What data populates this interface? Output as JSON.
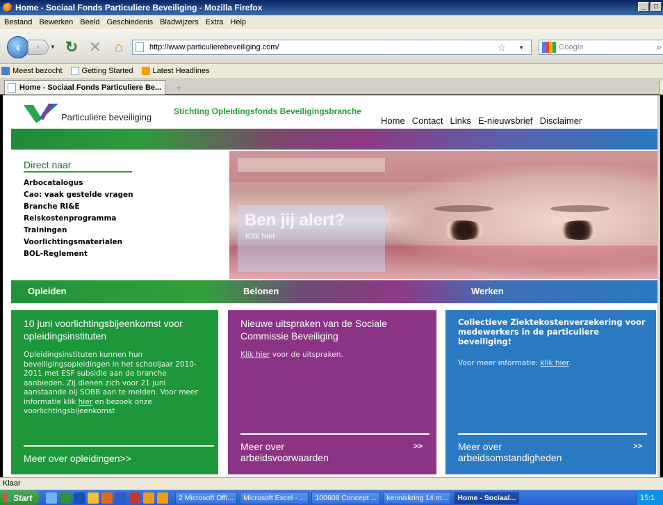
{
  "window": {
    "title": "Home - Sociaal Fonds Particuliere Beveiliging - Mozilla Firefox",
    "min_label": "_",
    "max_label": "□"
  },
  "menu": [
    "Bestand",
    "Bewerken",
    "Beeld",
    "Geschiedenis",
    "Bladwijzers",
    "Extra",
    "Help"
  ],
  "navbar": {
    "url": "http://www.particulierebeveiliging.com/",
    "search_placeholder": "Google"
  },
  "bookmarks": [
    "Meest bezocht",
    "Getting Started",
    "Latest Headlines"
  ],
  "tab": {
    "label": "Home - Sociaal Fonds Particuliere Be..."
  },
  "site": {
    "logo_text": "Particuliere beveiliging",
    "foundation": "Stichting Opleidingsfonds Beveiligingsbranche",
    "nav": [
      "Home",
      "Contact",
      "Links",
      "E-nieuwsbrief",
      "Disclaimer"
    ],
    "direct_title": "Direct naar",
    "direct_links": [
      "Arbocatalogus",
      "Cao: vaak gestelde vragen",
      "Branche RI&E",
      "Reiskostenprogramma",
      "Trainingen",
      "Voorlichtingsmaterialen",
      "BOL-Reglement"
    ],
    "hero_title": "Ben jij alert?",
    "hero_sub": "Klik hier",
    "categories": [
      "Opleiden",
      "Belonen",
      "Werken"
    ],
    "cards": {
      "green": {
        "title": "10 juni voorlichtingsbijeenkomst voor opleidingsinstituten",
        "body_before": "Opleidingsinstituten kunnen hun beveiligingsopleidingen in het schooljaar 2010-2011 met ESF subsidie aan de branche aanbieden. Zij dienen zich voor 21 juni aanstaande bij SOBB aan te melden. Voor meer informatie klik ",
        "link": "hier",
        "body_after": " en bezoek onze voorlichtingsbijeenkomst",
        "footer": "Meer over opleidingen>>"
      },
      "purple": {
        "title": "Nieuwe uitspraken van de Sociale Commissie Beveiliging",
        "link": "Klik hier",
        "body_after": " voor de uitspraken.",
        "footer_line1": "Meer over",
        "footer_line2": "arbeidsvoorwaarden",
        "arrow": ">>"
      },
      "blue": {
        "title": "Collectieve Ziektekostenverzekering voor medewerkers in de particuliere beveiliging!",
        "body_before": "Voor meer informatie: ",
        "link": "klik hier",
        "body_after": ".",
        "footer_line1": "Meer over",
        "footer_line2": "arbeidsomstandigheden",
        "arrow": ">>"
      }
    }
  },
  "status": "Klaar",
  "taskbar": {
    "start": "Start",
    "tasks": [
      "2 Microsoft Offi...",
      "Microsoft Excel - ...",
      "100608 Concept ...",
      "kenniskring 14 m...",
      "Home - Sociaal..."
    ],
    "clock": "15:1"
  }
}
